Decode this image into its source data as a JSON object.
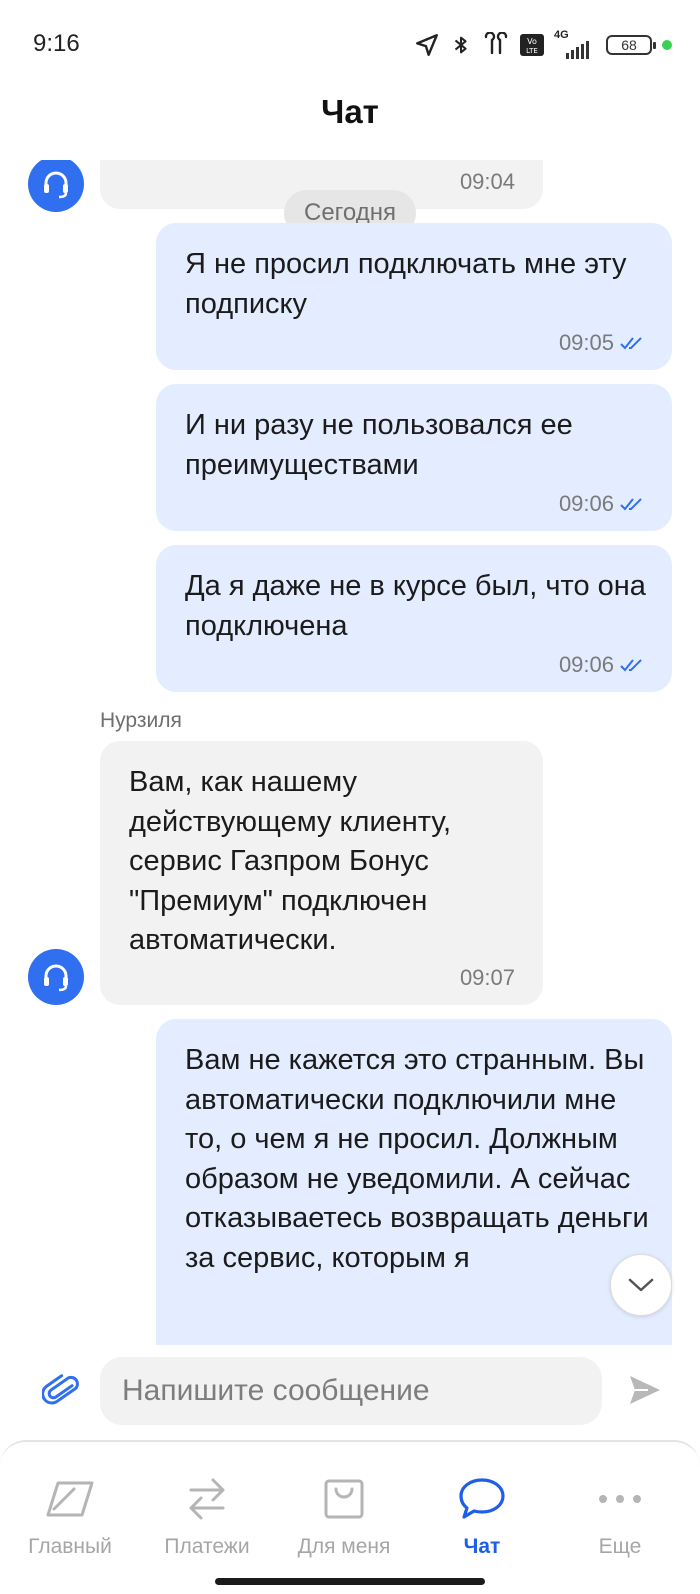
{
  "status_bar": {
    "time": "9:16",
    "battery": "68",
    "network": "4G",
    "volte": "Vo LTE"
  },
  "header": {
    "title": "Чат"
  },
  "chat": {
    "date_divider": "Сегодня",
    "messages": [
      {
        "from": "operator",
        "text": "",
        "time": "09:04"
      },
      {
        "from": "user",
        "text": "Я не просил подключать мне эту подписку",
        "time": "09:05",
        "read": true
      },
      {
        "from": "user",
        "text": "И ни разу не пользовался ее преимуществами",
        "time": "09:06",
        "read": true
      },
      {
        "from": "user",
        "text": "Да я даже не в курсе был, что она подключена",
        "time": "09:06",
        "read": true
      },
      {
        "from": "operator",
        "sender": "Нурзиля",
        "text": "Вам, как нашему действующему клиенту, сервис Газпром Бонус \"Премиум\" подключен автоматически.",
        "time": "09:07"
      },
      {
        "from": "user",
        "text": "Вам не кажется это странным. Вы автоматически подключили мне то, о чем я не просил. Должным образом не уведомили. А сейчас отказываетесь возвращать деньги за сервис, которым я",
        "time": ""
      }
    ]
  },
  "composer": {
    "placeholder": "Напишите сообщение"
  },
  "nav": {
    "items": [
      {
        "label": "Главный",
        "icon": "home-card-icon",
        "active": false
      },
      {
        "label": "Платежи",
        "icon": "transfer-arrows-icon",
        "active": false
      },
      {
        "label": "Для меня",
        "icon": "shopping-bag-icon",
        "active": false
      },
      {
        "label": "Чат",
        "icon": "chat-bubble-icon",
        "active": true
      },
      {
        "label": "Еще",
        "icon": "more-dots-icon",
        "active": false
      }
    ]
  },
  "colors": {
    "accent": "#1d5fe8",
    "avatar": "#2f6ff0",
    "outgoing_bubble": "#e3edff",
    "incoming_bubble": "#f2f2f2",
    "online_dot": "#3ccf55"
  }
}
